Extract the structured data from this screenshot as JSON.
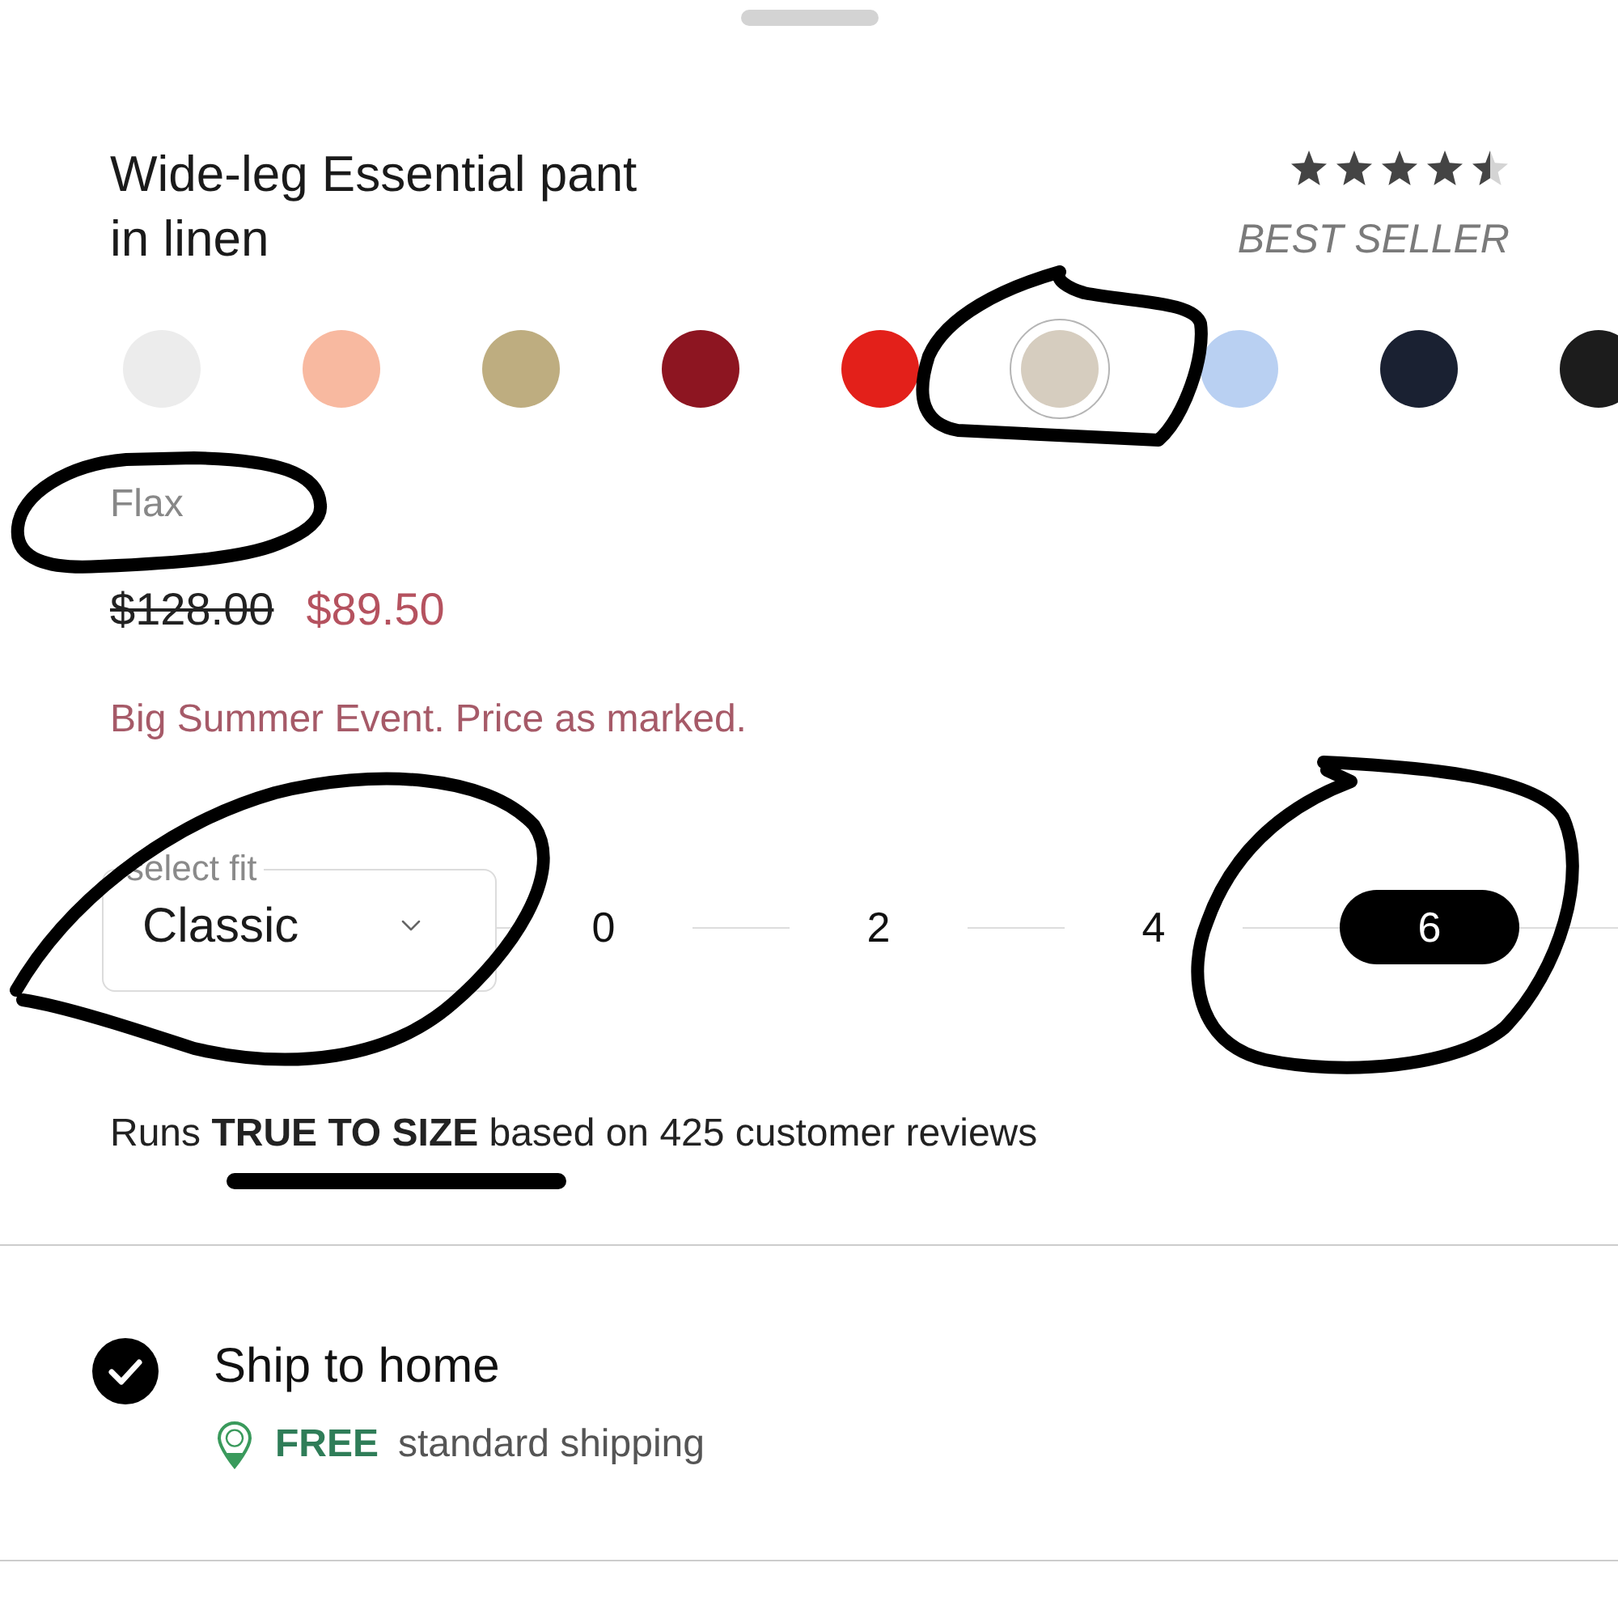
{
  "product": {
    "title": "Wide-leg Essential pant in linen",
    "rating": {
      "stars": 4.5
    },
    "badge": "BEST SELLER"
  },
  "swatches": [
    {
      "color": "#ececec",
      "selected": false
    },
    {
      "color": "#f8b9a0",
      "selected": false
    },
    {
      "color": "#bead80",
      "selected": false
    },
    {
      "color": "#8d1521",
      "selected": false
    },
    {
      "color": "#e3201a",
      "selected": false
    },
    {
      "color": "#d6cdbf",
      "selected": true
    },
    {
      "color": "#b9d0f2",
      "selected": false
    },
    {
      "color": "#1a2132",
      "selected": false
    },
    {
      "color": "#1c1c1c",
      "selected": false
    }
  ],
  "selected_color_name": "Flax",
  "price": {
    "original": "$128.00",
    "sale": "$89.50"
  },
  "promo": "Big Summer Event. Price as marked.",
  "fit_select": {
    "label": "select fit",
    "value": "Classic"
  },
  "sizes": [
    {
      "label": "0",
      "selected": false
    },
    {
      "label": "2",
      "selected": false
    },
    {
      "label": "4",
      "selected": false
    },
    {
      "label": "6",
      "selected": true
    }
  ],
  "fit_note": "Runs **TRUE TO SIZE** based on 425 customer reviews",
  "shipping_options": [
    {
      "selected": true,
      "title": "Ship to home",
      "badge": "FREE",
      "detail": "standard shipping"
    }
  ]
}
